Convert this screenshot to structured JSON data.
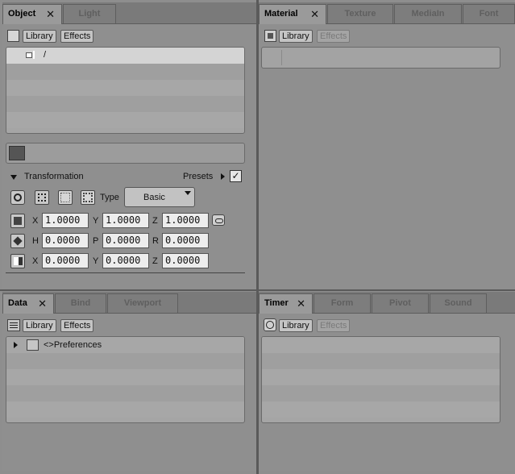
{
  "object_panel": {
    "tabs": [
      {
        "label": "Object",
        "close": "✕",
        "active": true
      },
      {
        "label": "Light"
      }
    ],
    "library_label": "Library",
    "effects_label": "Effects",
    "tree_root_label": "/",
    "section_title": "Transformation",
    "presets_label": "Presets",
    "presets_checked": true,
    "type_label": "Type",
    "type_value": "Basic",
    "rows": [
      {
        "a_label": "X",
        "a_value": "1.0000",
        "b_label": "Y",
        "b_value": "1.0000",
        "c_label": "Z",
        "c_value": "1.0000"
      },
      {
        "a_label": "H",
        "a_value": "0.0000",
        "b_label": "P",
        "b_value": "0.0000",
        "c_label": "R",
        "c_value": "0.0000"
      },
      {
        "a_label": "X",
        "a_value": "0.0000",
        "b_label": "Y",
        "b_value": "0.0000",
        "c_label": "Z",
        "c_value": "0.0000"
      }
    ]
  },
  "material_panel": {
    "tabs": [
      {
        "label": "Material",
        "close": "✕",
        "active": true
      },
      {
        "label": "Texture"
      },
      {
        "label": "MediaIn"
      },
      {
        "label": "Font"
      }
    ],
    "library_label": "Library",
    "effects_label": "Effects"
  },
  "data_panel": {
    "tabs": [
      {
        "label": "Data",
        "close": "✕",
        "active": true
      },
      {
        "label": "Bind"
      },
      {
        "label": "Viewport"
      }
    ],
    "library_label": "Library",
    "effects_label": "Effects",
    "tree_item_label": "<>Preferences"
  },
  "timer_panel": {
    "tabs": [
      {
        "label": "Timer",
        "close": "✕",
        "active": true
      },
      {
        "label": "Form"
      },
      {
        "label": "Pivot"
      },
      {
        "label": "Sound"
      }
    ],
    "library_label": "Library",
    "effects_label": "Effects"
  },
  "colors": {
    "background": "#8e8e8e",
    "tabbar": "#7a7a7a",
    "field": "#ededed"
  }
}
